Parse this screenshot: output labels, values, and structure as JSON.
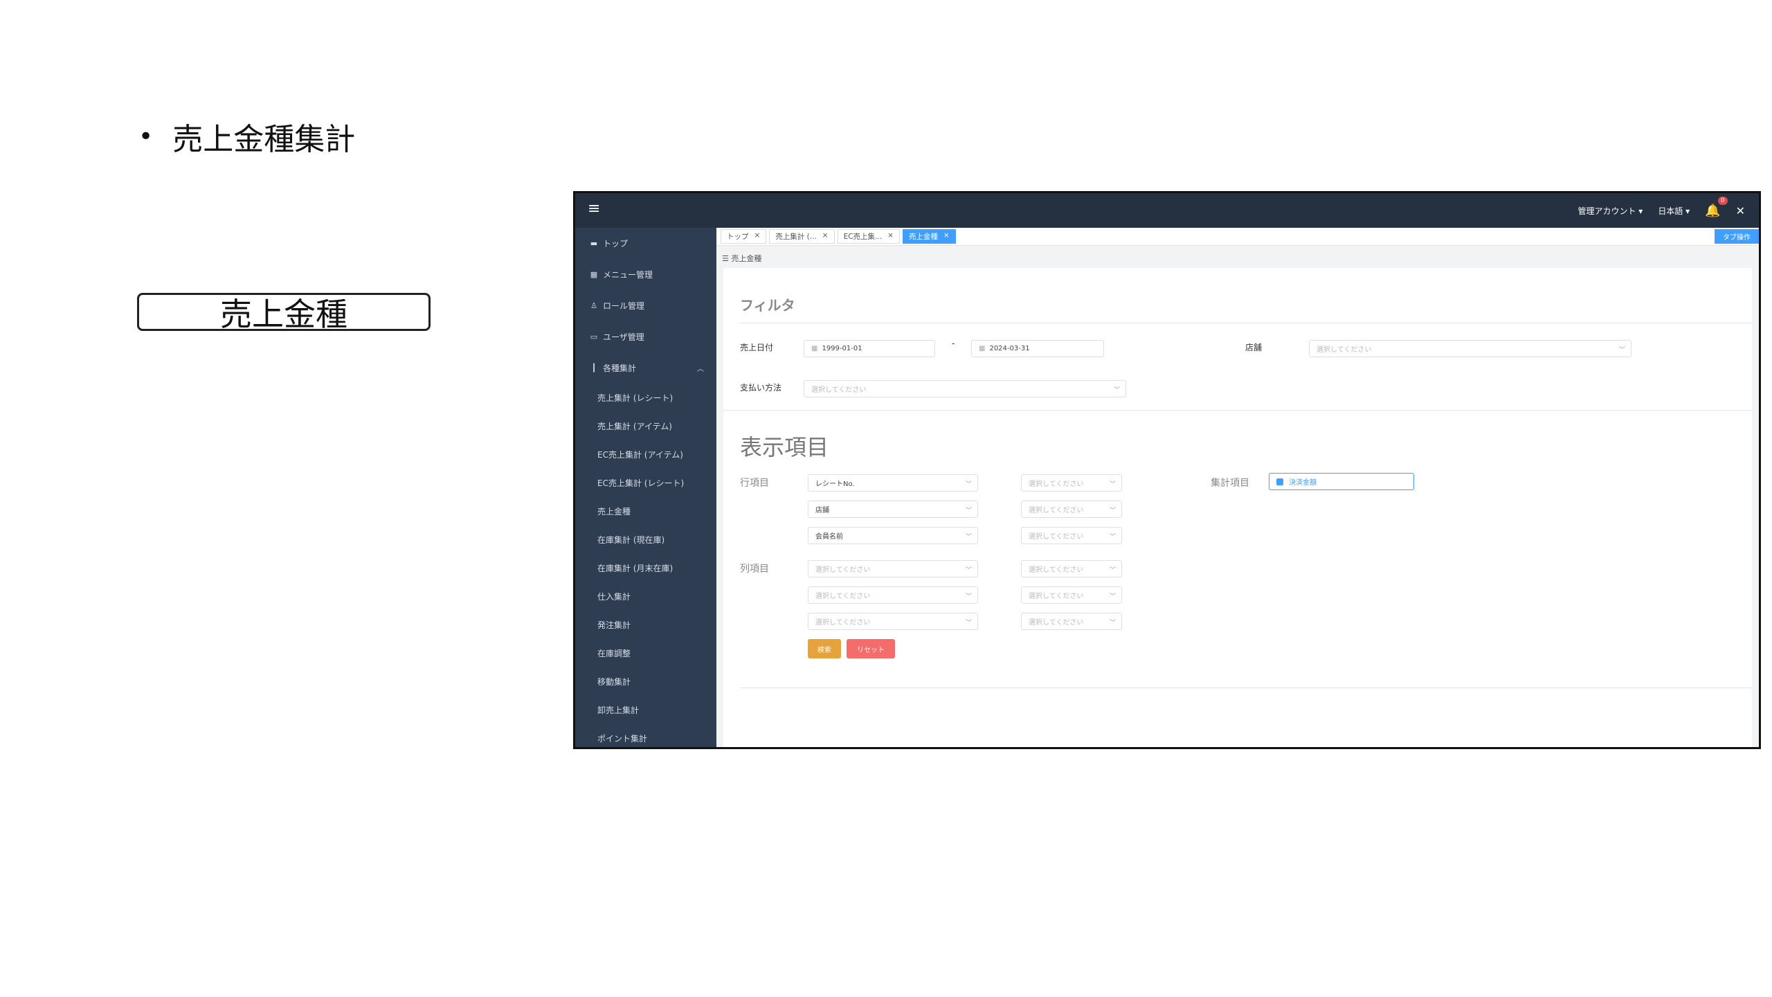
{
  "slide": {
    "bullet_text": "売上金種集計",
    "boxed_label": "売上金種"
  },
  "topbar": {
    "account": "管理アカウント",
    "language": "日本語",
    "notification_count": "0"
  },
  "sidebar": {
    "top": "トップ",
    "menu_admin": "メニュー管理",
    "role_admin": "ロール管理",
    "user_admin": "ユーザ管理",
    "reports": "各種集計",
    "sub": [
      "売上集計 (レシート)",
      "売上集計 (アイテム)",
      "EC売上集計 (アイテム)",
      "EC売上集計 (レシート)",
      "売上金種",
      "在庫集計 (現在庫)",
      "在庫集計 (月末在庫)",
      "仕入集計",
      "発注集計",
      "在庫調整",
      "移動集計",
      "卸売上集計",
      "ポイント集計"
    ]
  },
  "tabs": {
    "items": [
      "トップ",
      "売上集計 (...",
      "EC売上集...",
      "売上金種"
    ],
    "operation": "タブ操作"
  },
  "breadcrumb": "売上金種",
  "filter": {
    "title": "フィルタ",
    "sales_date_label": "売上日付",
    "date_from": "1999-01-01",
    "date_sep": "-",
    "date_to": "2024-03-31",
    "store_label": "店舗",
    "placeholder": "選択してください",
    "payment_label": "支払い方法"
  },
  "display": {
    "title": "表示項目",
    "row_label": "行項目",
    "row_values": [
      "レシートNo.",
      "店舗",
      "会員名前"
    ],
    "col_label": "列項目",
    "agg_label": "集計項目",
    "agg_value": "決済金額",
    "search_button": "検索",
    "reset_button": "リセット"
  },
  "colors": {
    "topbar": "#253041",
    "sidebar": "#2f3d52",
    "accent": "#409eff",
    "search": "#e6a23c",
    "reset": "#f56c6c"
  }
}
